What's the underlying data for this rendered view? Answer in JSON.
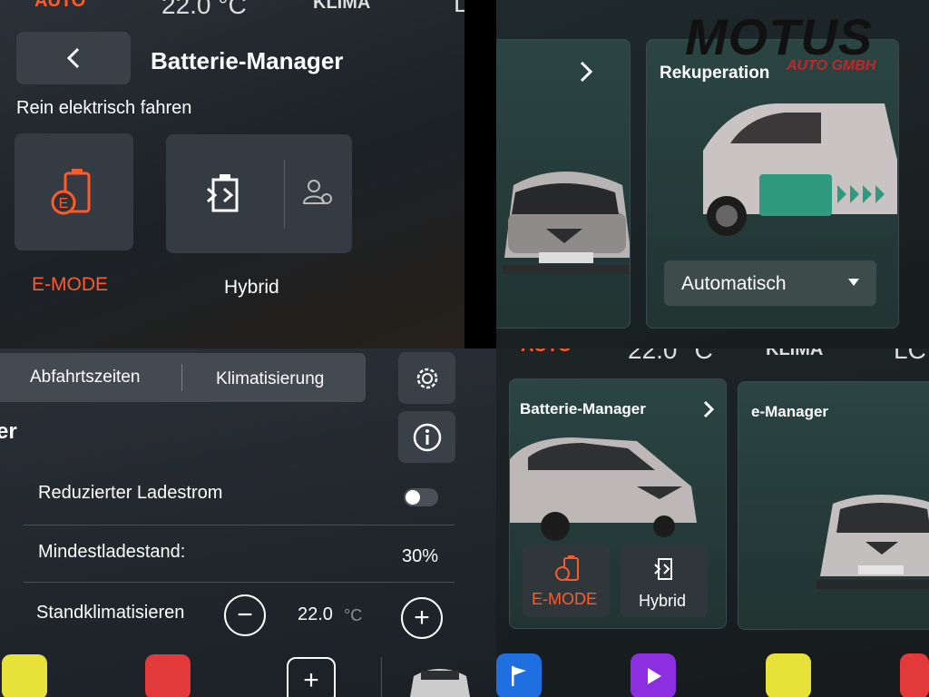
{
  "status_top": {
    "left": "AUTO",
    "temp": "22.0 °C",
    "center": "KLIMA",
    "right": "LC"
  },
  "status_q4": {
    "left": "AUTO",
    "temp": "22.0 °C",
    "center": "KLIMA",
    "right": "LC"
  },
  "battery_screen": {
    "title": "Batterie-Manager",
    "subtitle": "Rein elektrisch fahren",
    "modes": [
      {
        "label": "E-MODE",
        "icon": "e-mode-battery-icon",
        "color": "#ff5a2a"
      },
      {
        "label": "Hybrid",
        "icon": "hybrid-icon"
      }
    ]
  },
  "recuperation": {
    "title": "Rekuperation",
    "dropdown_value": "Automatisch"
  },
  "watermark": {
    "brand": "MOTUS",
    "sub": "AUTO GMBH"
  },
  "charging_settings": {
    "tabs": [
      "Abfahrtszeiten",
      "Klimatisierung"
    ],
    "partial_title": "er",
    "rows": [
      {
        "label": "Reduzierter Ladestrom"
      },
      {
        "label": "Mindestladestand:",
        "value": "30%"
      },
      {
        "label": "Standklimatisieren",
        "value": "22.0",
        "unit": "°C"
      }
    ]
  },
  "home": {
    "card1_title": "Batterie-Manager",
    "card2_title": "e-Manager",
    "modes": [
      "E-MODE",
      "Hybrid"
    ]
  },
  "colors": {
    "accent": "#ff5a2a",
    "teal": "#2a8f78"
  }
}
